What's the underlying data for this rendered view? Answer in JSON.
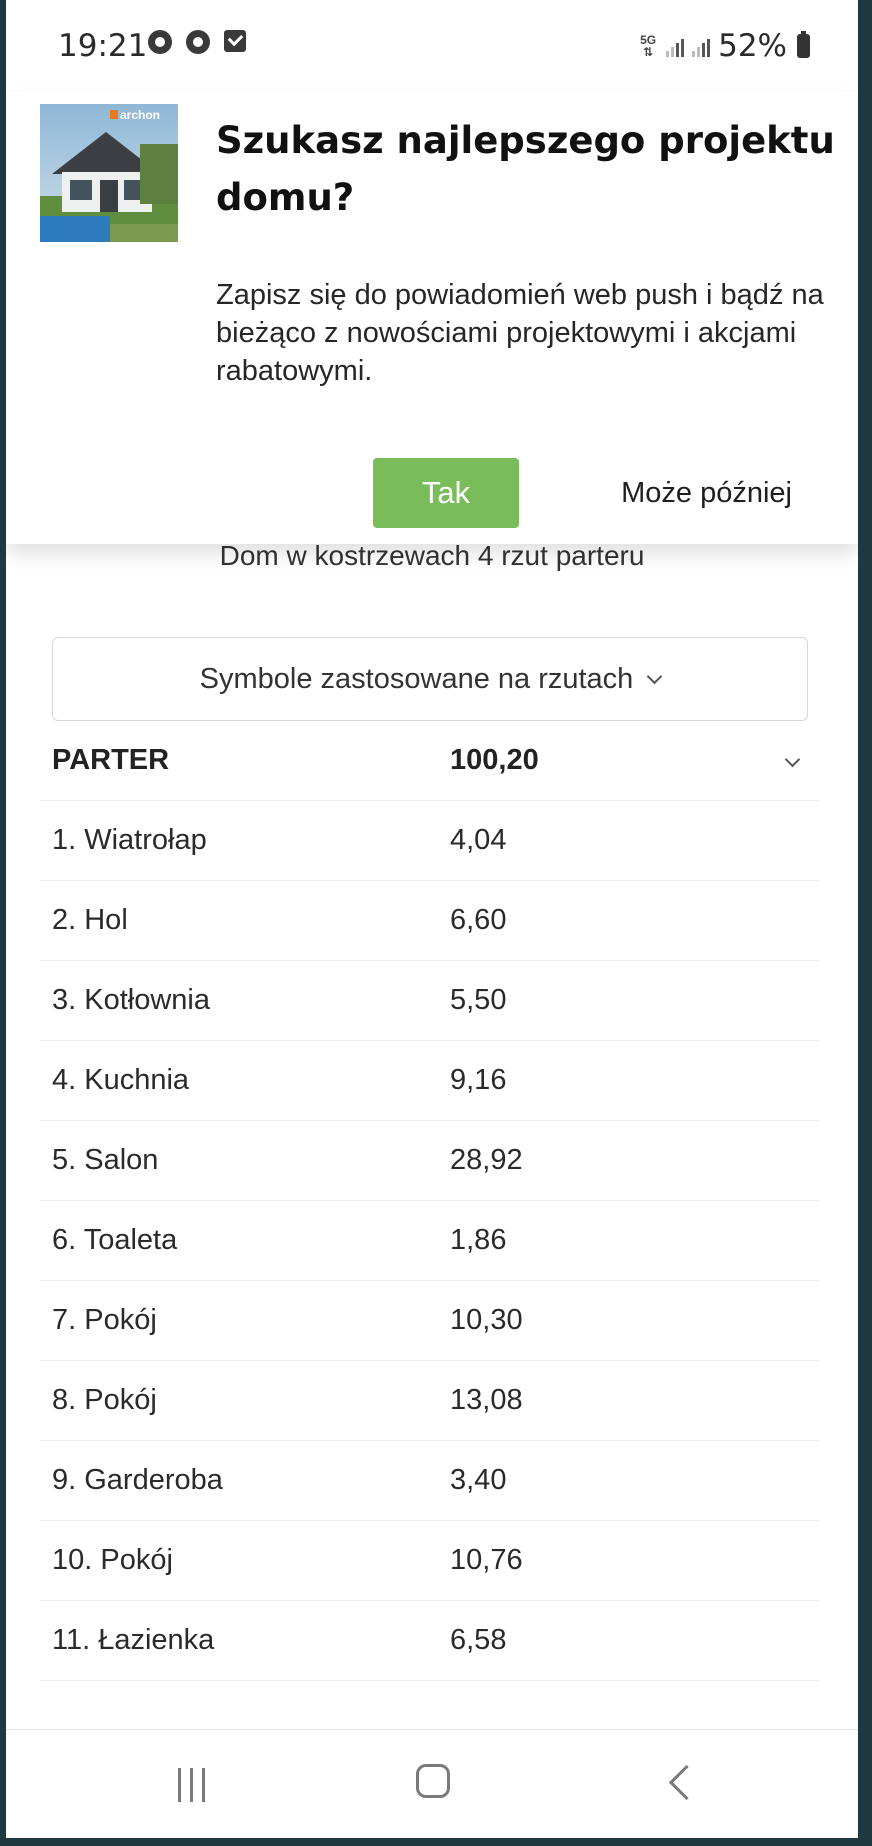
{
  "status_bar": {
    "time": "19:21",
    "network": "5G",
    "battery": "52%"
  },
  "popup": {
    "brand": "archon",
    "title": "Szukasz najlepszego projektu domu?",
    "body": "Zapisz się do powiadomień web push i bądź na bieżąco z nowościami projektowymi i akcjami rabatowymi.",
    "yes_label": "Tak",
    "later_label": "Może później",
    "accent_color": "#79bd5a"
  },
  "page": {
    "plan_title": "Dom w kostrzewach 4 rzut parteru",
    "symbols_label": "Symbole zastosowane na rzutach",
    "floor": {
      "name": "PARTER",
      "total": "100,20"
    },
    "rooms": [
      {
        "name": "1. Wiatrołap",
        "area": "4,04"
      },
      {
        "name": "2. Hol",
        "area": "6,60"
      },
      {
        "name": "3. Kotłownia",
        "area": "5,50"
      },
      {
        "name": "4. Kuchnia",
        "area": "9,16"
      },
      {
        "name": "5. Salon",
        "area": "28,92"
      },
      {
        "name": "6. Toaleta",
        "area": "1,86"
      },
      {
        "name": "7. Pokój",
        "area": "10,30"
      },
      {
        "name": "8. Pokój",
        "area": "13,08"
      },
      {
        "name": "9. Garderoba",
        "area": "3,40"
      },
      {
        "name": "10. Pokój",
        "area": "10,76"
      },
      {
        "name": "11. Łazienka",
        "area": "6,58"
      }
    ]
  },
  "icons": {
    "status_left": [
      "chrome-icon",
      "chrome-icon",
      "checkbox-icon"
    ],
    "nav": [
      "recent-apps-icon",
      "home-icon",
      "back-icon"
    ]
  }
}
